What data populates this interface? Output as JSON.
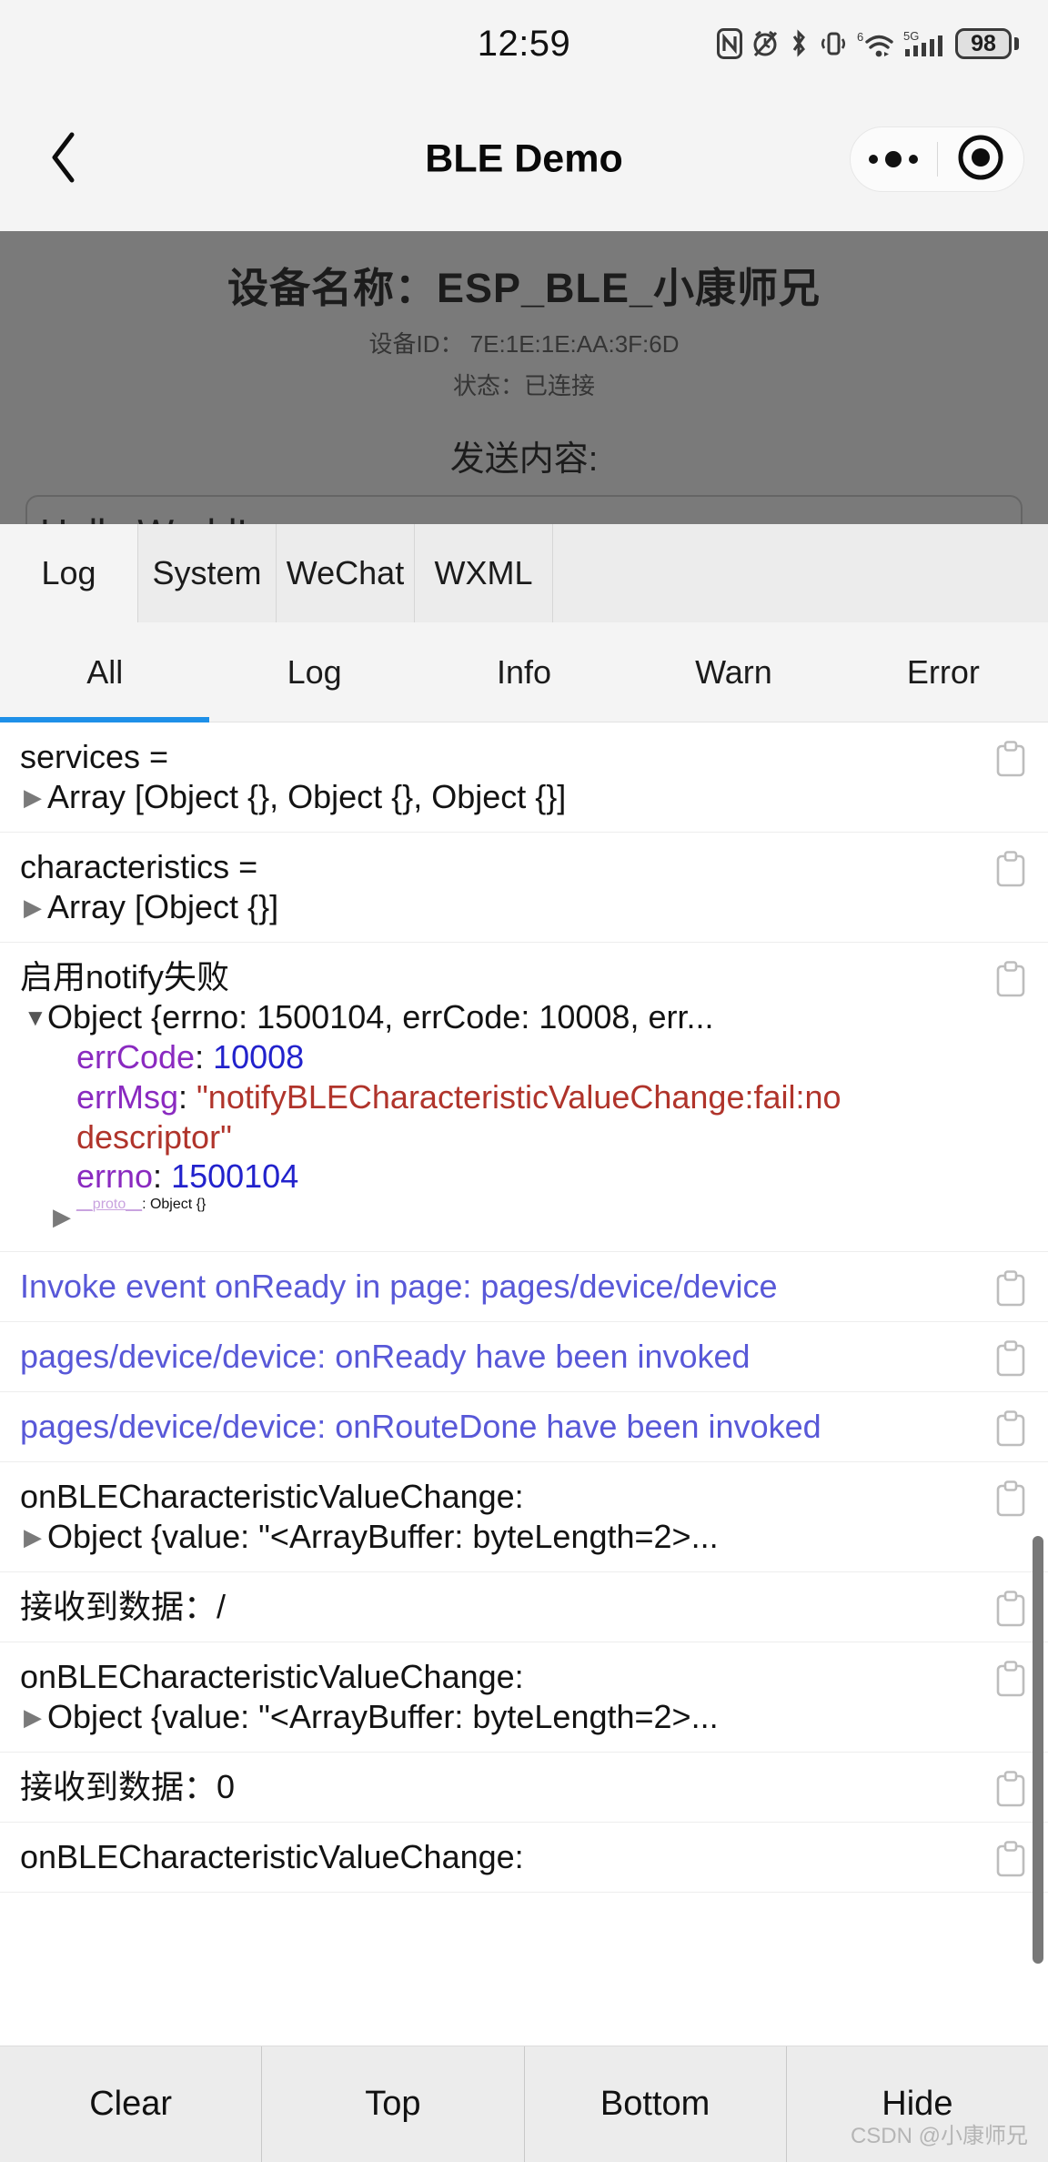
{
  "status_bar": {
    "time": "12:59",
    "battery_level": "98",
    "icons": [
      "nfc-icon",
      "alarm-muted-icon",
      "bluetooth-icon",
      "vibrate-icon",
      "wifi6-icon",
      "signal-5g-icon",
      "battery-icon"
    ]
  },
  "nav_bar": {
    "back_icon": "chevron-left-icon",
    "title": "BLE Demo",
    "more_icon": "more-dots-icon",
    "target_icon": "target-circle-icon"
  },
  "app_view": {
    "device_name_line": "设备名称：ESP_BLE_小康师兄",
    "device_id_line": "设备ID： 7E:1E:1E:AA:3F:6D",
    "state_line": "状态：已连接",
    "send_label": "发送内容:",
    "send_value": "Hello World!"
  },
  "debugger": {
    "tabs": [
      {
        "label": "Log",
        "active": true
      },
      {
        "label": "System",
        "active": false
      },
      {
        "label": "WeChat",
        "active": false
      },
      {
        "label": "WXML",
        "active": false
      }
    ],
    "filters": [
      {
        "label": "All",
        "active": true
      },
      {
        "label": "Log",
        "active": false
      },
      {
        "label": "Info",
        "active": false
      },
      {
        "label": "Warn",
        "active": false
      },
      {
        "label": "Error",
        "active": false
      }
    ],
    "copy_icon": "clipboard-copy-icon",
    "rows": [
      {
        "kind": "object",
        "title": "services =",
        "expander": "collapsed",
        "summary": "Array [Object {}, Object {}, Object {}]"
      },
      {
        "kind": "object",
        "title": "characteristics =",
        "expander": "collapsed",
        "summary": "Array [Object {}]"
      },
      {
        "kind": "expanded-object",
        "title": "启用notify失败",
        "expander": "expanded",
        "summary": "Object {errno: 1500104, errCode: 10008, err...",
        "props": [
          {
            "key": "errCode",
            "sep": ": ",
            "value": "10008",
            "value_type": "number"
          },
          {
            "key": "errMsg",
            "sep": ": ",
            "value": "\"notifyBLECharacteristicValueChange:fail:no descriptor\"",
            "value_type": "string"
          },
          {
            "key": "errno",
            "sep": ": ",
            "value": "1500104",
            "value_type": "number"
          },
          {
            "key": "__proto__",
            "sep": ": ",
            "value": "Object {}",
            "value_type": "object",
            "expander": "collapsed"
          }
        ]
      },
      {
        "kind": "plain",
        "color": "blue",
        "title": "Invoke event onReady in page: pages/device/device"
      },
      {
        "kind": "plain",
        "color": "blue",
        "title": "pages/device/device: onReady have been invoked"
      },
      {
        "kind": "plain",
        "color": "blue",
        "title": "pages/device/device: onRouteDone have been invoked"
      },
      {
        "kind": "object",
        "title": "onBLECharacteristicValueChange:",
        "expander": "collapsed",
        "summary": "Object {value: \"<ArrayBuffer: byteLength=2>..."
      },
      {
        "kind": "plain",
        "color": "dark",
        "title": "接收到数据：/"
      },
      {
        "kind": "object",
        "title": "onBLECharacteristicValueChange:",
        "expander": "collapsed",
        "summary": "Object {value: \"<ArrayBuffer: byteLength=2>..."
      },
      {
        "kind": "plain",
        "color": "dark",
        "title": "接收到数据：0"
      },
      {
        "kind": "plain",
        "color": "dark",
        "title": "onBLECharacteristicValueChange:"
      }
    ],
    "footer_buttons": [
      "Clear",
      "Top",
      "Bottom",
      "Hide"
    ]
  },
  "watermark": "CSDN @小康师兄",
  "colors": {
    "accent_blue": "#1e90e8",
    "log_blue": "#5858d8",
    "key_purple": "#8a2ac0",
    "number_blue": "#2222cc",
    "string_red": "#b0342b",
    "panel_bg": "#ffffff",
    "tab_bg": "#ececec"
  }
}
